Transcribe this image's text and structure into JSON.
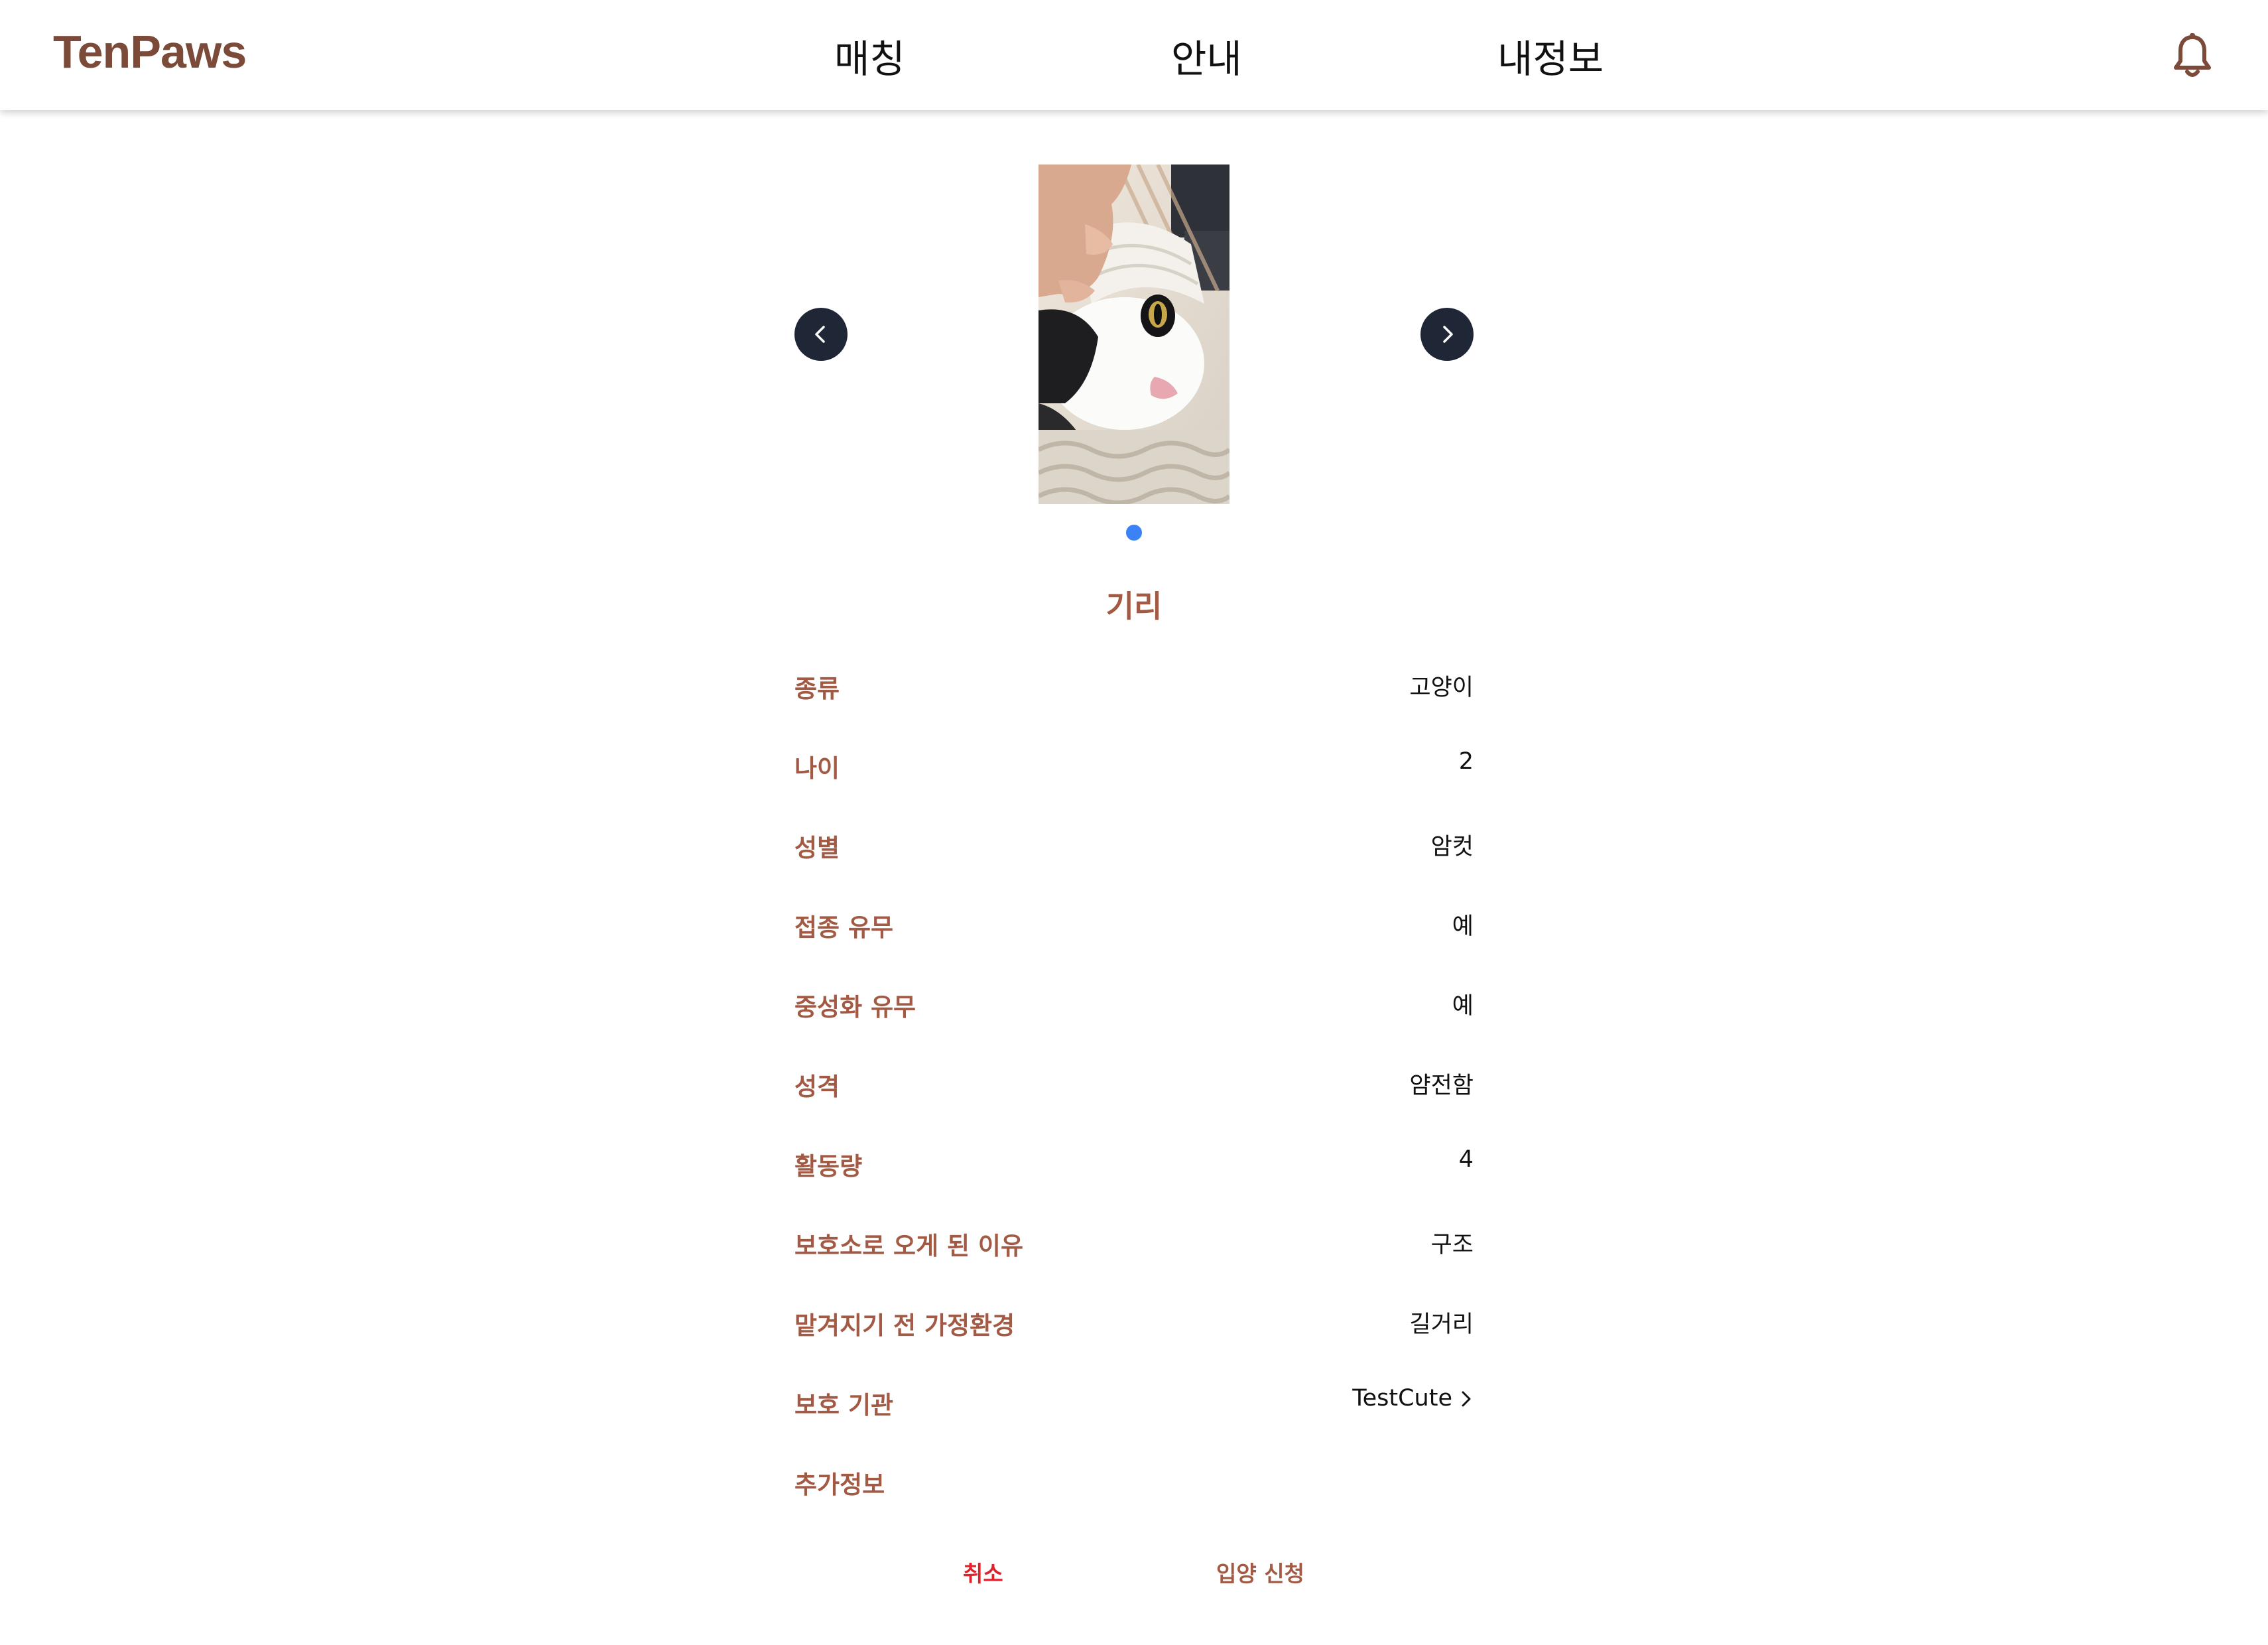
{
  "header": {
    "logo": "TenPaws",
    "nav": {
      "matching": "매칭",
      "guide": "안내",
      "my_info": "내정보"
    },
    "notification_icon": "bell-icon"
  },
  "carousel": {
    "prev_icon": "chevron-left-icon",
    "next_icon": "chevron-right-icon",
    "image_subject": "black-and-white cat wrapped in a white blanket being petted",
    "total_images": 1,
    "active_index": 0
  },
  "pet": {
    "name": "기리",
    "fields": [
      {
        "label": "종류",
        "value": "고양이"
      },
      {
        "label": "나이",
        "value": "2"
      },
      {
        "label": "성별",
        "value": "암컷"
      },
      {
        "label": "접종 유무",
        "value": "예"
      },
      {
        "label": "중성화 유무",
        "value": "예"
      },
      {
        "label": "성격",
        "value": "얌전함"
      },
      {
        "label": "활동량",
        "value": "4"
      },
      {
        "label": "보호소로 오게 된 이유",
        "value": "구조"
      },
      {
        "label": "맡겨지기 전 가정환경",
        "value": "길거리"
      },
      {
        "label": "보호 기관",
        "value": "TestCute"
      },
      {
        "label": "추가정보",
        "value": ""
      }
    ]
  },
  "actions": {
    "cancel": "취소",
    "apply": "입양 신청"
  },
  "colors": {
    "brand": "#7b4a38",
    "label": "#a35a44",
    "cancel": "#e0202a",
    "arrow_bg": "#1f2737",
    "dot_active": "#3b82f6"
  }
}
